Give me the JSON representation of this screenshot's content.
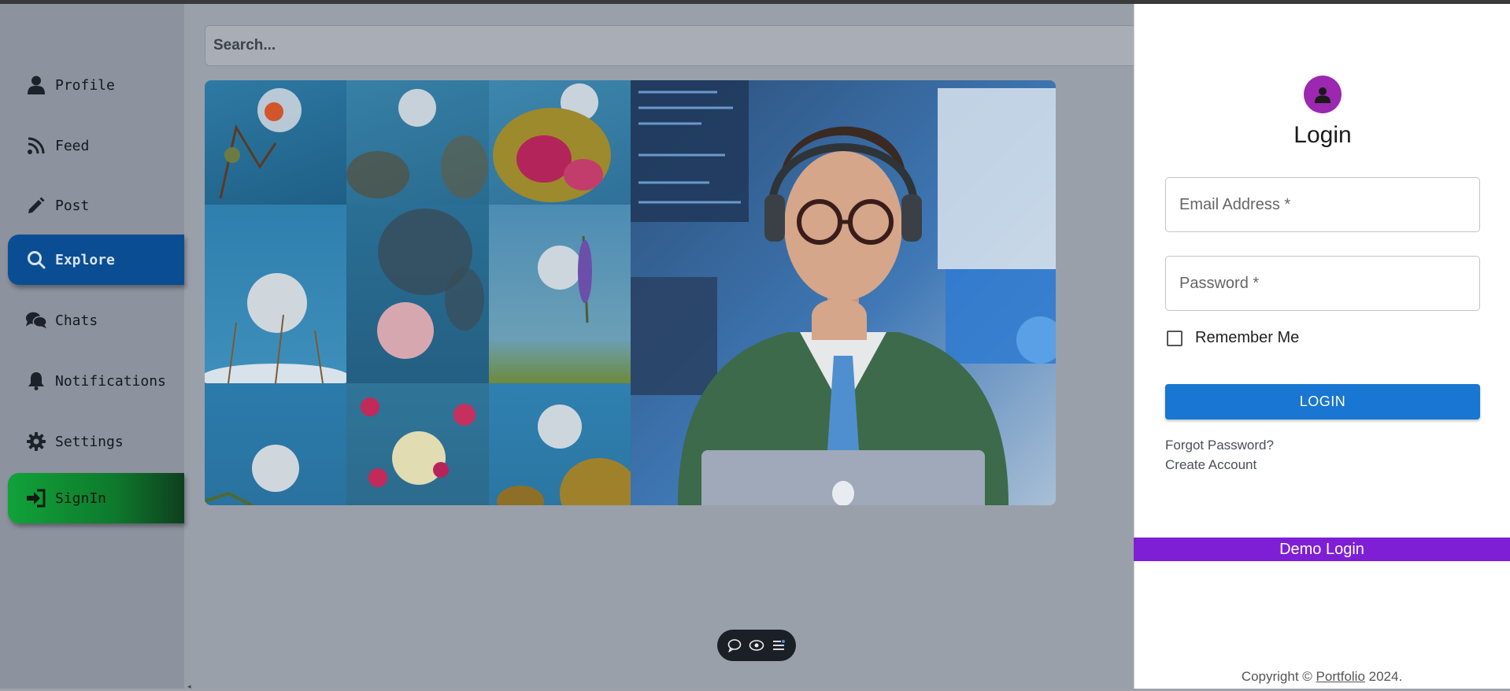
{
  "sidebar": {
    "items": [
      {
        "label": "Profile",
        "icon": "user-icon"
      },
      {
        "label": "Feed",
        "icon": "rss-icon"
      },
      {
        "label": "Post",
        "icon": "pencil-icon"
      },
      {
        "label": "Explore",
        "icon": "search-icon",
        "active": true
      },
      {
        "label": "Chats",
        "icon": "comments-icon"
      },
      {
        "label": "Notifications",
        "icon": "bell-icon"
      },
      {
        "label": "Settings",
        "icon": "gear-icon"
      },
      {
        "label": "SignIn",
        "icon": "sign-in-icon"
      }
    ]
  },
  "search": {
    "placeholder": "Search..."
  },
  "floating_toolbar": {
    "icons": [
      "chat-bubble-icon",
      "eye-icon",
      "menu-list-icon"
    ]
  },
  "login": {
    "title": "Login",
    "email_placeholder": "Email Address *",
    "password_placeholder": "Password *",
    "remember_label": "Remember Me",
    "login_button": "LOGIN",
    "forgot_password": "Forgot Password?",
    "create_account": "Create Account",
    "demo_login": "Demo Login",
    "copyright_prefix": "Copyright © ",
    "copyright_link": "Portfolio",
    "copyright_suffix": " 2024."
  },
  "colors": {
    "active_nav": "#0b4d93",
    "signin_green": "#11a23a",
    "login_button": "#1976d2",
    "demo_bar": "#7e1fd6",
    "avatar": "#9c27b0"
  }
}
